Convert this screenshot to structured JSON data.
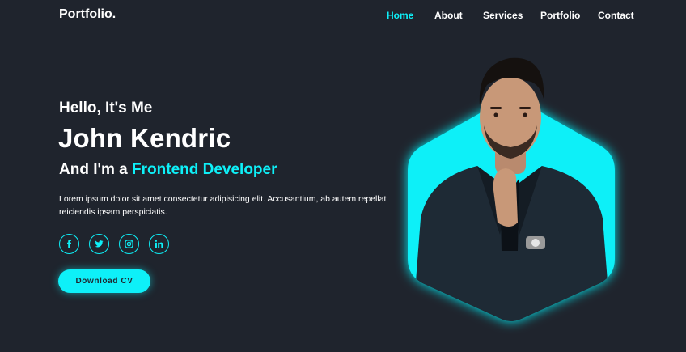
{
  "header": {
    "logo": "Portfolio.",
    "nav": [
      {
        "label": "Home",
        "active": true
      },
      {
        "label": "About",
        "active": false
      },
      {
        "label": "Services",
        "active": false
      },
      {
        "label": "Portfolio",
        "active": false
      },
      {
        "label": "Contact",
        "active": false
      }
    ]
  },
  "hero": {
    "greeting": "Hello, It's Me",
    "name": "John Kendric",
    "role_prefix": "And I'm a ",
    "role_highlight": "Frontend Developer",
    "description": "Lorem ipsum dolor sit amet consectetur adipisicing elit. Accusantium, ab autem repellat reiciendis ipsam perspiciatis.",
    "socials": [
      {
        "icon": "facebook-icon"
      },
      {
        "icon": "twitter-icon"
      },
      {
        "icon": "instagram-icon"
      },
      {
        "icon": "linkedin-icon"
      }
    ],
    "cta_label": "Download CV"
  },
  "colors": {
    "background": "#1f242d",
    "accent": "#0ef0f8",
    "text": "#ffffff"
  }
}
